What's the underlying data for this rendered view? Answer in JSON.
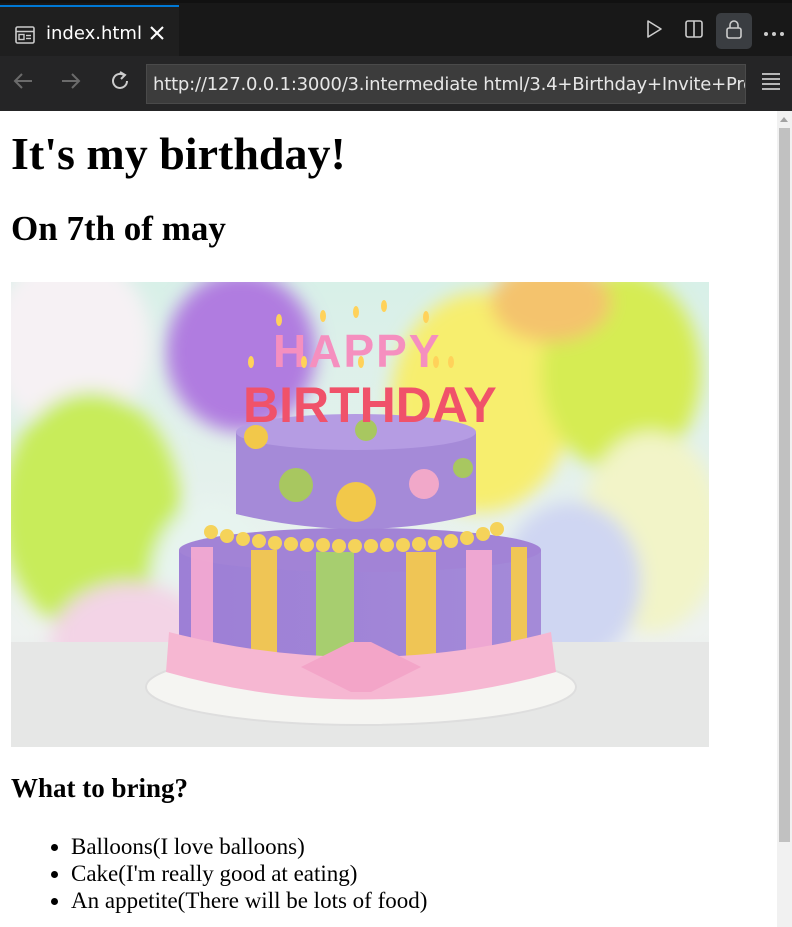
{
  "tab": {
    "title": "index.html"
  },
  "toolbar": {
    "icons": [
      "file-preview-icon",
      "close-icon",
      "run-icon",
      "split-editor-icon",
      "lock-icon",
      "more-icon"
    ]
  },
  "nav": {
    "url": "http://127.0.0.1:3000/3.intermediate html/3.4+Birthday+Invite+Pro"
  },
  "page": {
    "heading": "It's my birthday!",
    "date": "On 7th of may",
    "image_text": "HAPPY BIRTHDAY",
    "bring_heading": "What to bring?",
    "items": [
      "Balloons(I love balloons)",
      "Cake(I'm really good at eating)",
      "An appetite(There will be lots of food)"
    ]
  },
  "colors": {
    "accent": "#0078d4",
    "page_bg": "#ffffff",
    "chrome_bg": "#1f1f1f"
  }
}
